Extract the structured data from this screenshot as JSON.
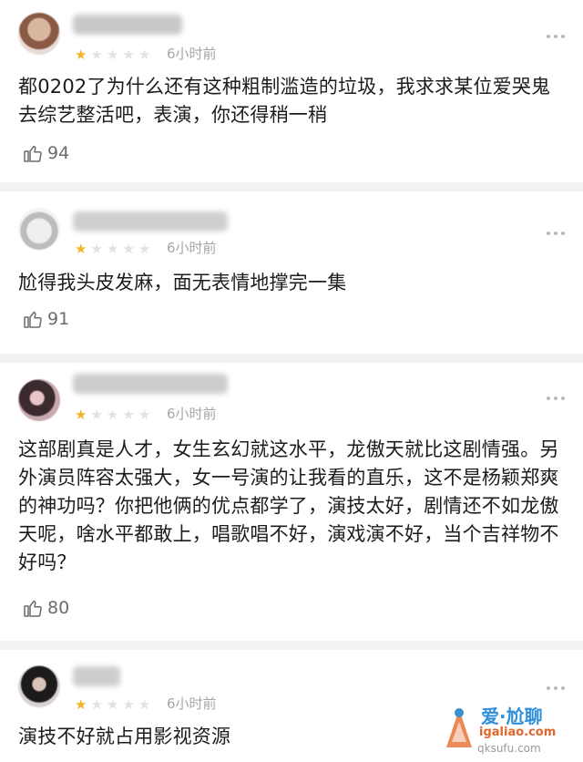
{
  "comments": [
    {
      "stars_filled": 1,
      "stars_total": 5,
      "time": "6小时前",
      "text": "都0202了为什么还有这种粗制滥造的垃圾，我求求某位爱哭鬼去综艺整活吧，表演，你还得稍一稍",
      "likes": "94"
    },
    {
      "stars_filled": 1,
      "stars_total": 5,
      "time": "6小时前",
      "text": "尬得我头皮发麻，面无表情地撑完一集",
      "likes": "91"
    },
    {
      "stars_filled": 1,
      "stars_total": 5,
      "time": "6小时前",
      "text": "这部剧真是人才，女生玄幻就这水平，龙傲天就比这剧情强。另外演员阵容太强大，女一号演的让我看的直乐，这不是杨颖郑爽的神功吗？你把他俩的优点都学了，演技太好，剧情还不如龙傲天呢，啥水平都敢上，唱歌唱不好，演戏演不好，当个吉祥物不好吗？",
      "likes": "80"
    },
    {
      "stars_filled": 1,
      "stars_total": 5,
      "time": "6小时前",
      "text": "演技不好就占用影视资源",
      "likes": ""
    }
  ],
  "watermark": {
    "line1": "爱·尬聊",
    "line2": "igaliao.com",
    "line3": "qksufu.com"
  },
  "colors": {
    "star_on": "#f3b327",
    "star_off": "#e2e2e2",
    "time": "#a6a6a6",
    "divider": "#f2f2f2"
  }
}
